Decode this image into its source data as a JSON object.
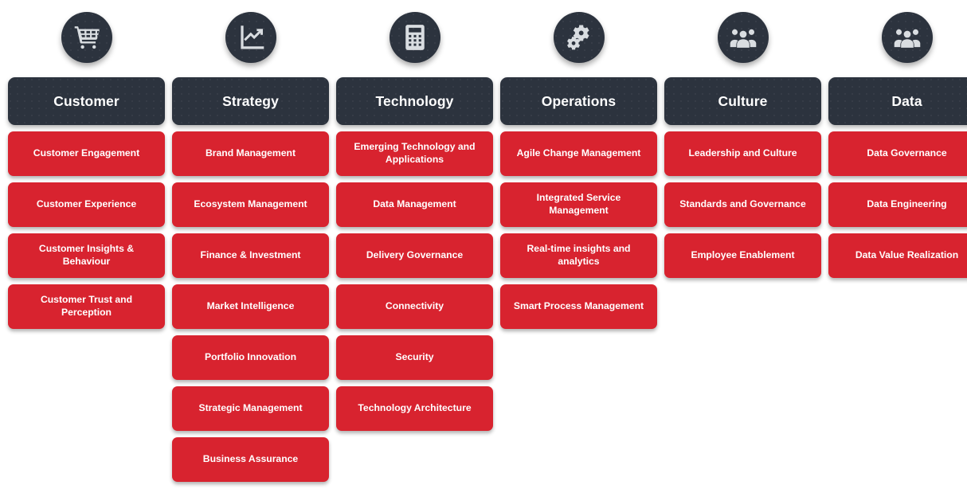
{
  "theme": {
    "background": "#ffffff",
    "header_color": "#2c333e",
    "card_color": "#d8232f",
    "text_color": "#ffffff"
  },
  "columns": [
    {
      "id": "customer",
      "icon": "shopping-cart-icon",
      "title": "Customer",
      "items": [
        "Customer Engagement",
        "Customer Experience",
        "Customer Insights & Behaviour",
        "Customer Trust and Perception"
      ]
    },
    {
      "id": "strategy",
      "icon": "line-chart-growth-icon",
      "title": "Strategy",
      "items": [
        "Brand Management",
        "Ecosystem Management",
        "Finance & Investment",
        "Market Intelligence",
        "Portfolio Innovation",
        "Strategic Management",
        "Business Assurance"
      ]
    },
    {
      "id": "technology",
      "icon": "calculator-icon",
      "title": "Technology",
      "items": [
        "Emerging Technology and Applications",
        "Data Management",
        "Delivery Governance",
        "Connectivity",
        "Security",
        "Technology Architecture"
      ]
    },
    {
      "id": "operations",
      "icon": "gears-icon",
      "title": "Operations",
      "items": [
        "Agile Change Management",
        "Integrated Service Management",
        "Real-time insights and analytics",
        "Smart Process Management"
      ]
    },
    {
      "id": "culture",
      "icon": "people-group-icon",
      "title": "Culture",
      "items": [
        "Leadership and Culture",
        "Standards and Governance",
        "Employee Enablement"
      ]
    },
    {
      "id": "data",
      "icon": "people-group-icon",
      "title": "Data",
      "items": [
        "Data Governance",
        "Data Engineering",
        "Data Value Realization"
      ]
    }
  ]
}
